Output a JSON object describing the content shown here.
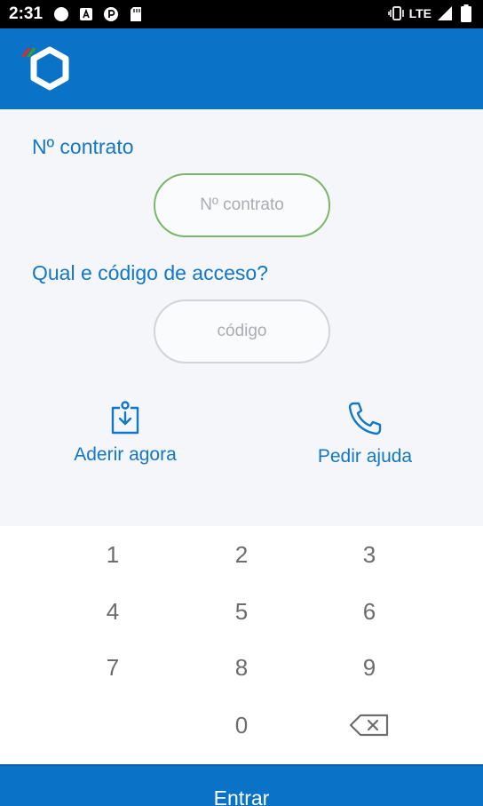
{
  "status_bar": {
    "time": "2:31",
    "network": "LTE",
    "icons": [
      "circle-icon",
      "font-a-icon",
      "pocket-p-icon",
      "sd-card-icon",
      "vibrate-icon",
      "signal-icon",
      "battery-icon"
    ]
  },
  "header": {
    "logo_icon": "cgd-logo-icon",
    "brand_color": "#0a73c8",
    "accent_colors": [
      "#e02a2a",
      "#2ea02e"
    ]
  },
  "form": {
    "contract": {
      "label": "Nº contrato",
      "placeholder": "Nº contrato",
      "value": ""
    },
    "code": {
      "label": "Qual e código de acceso?",
      "placeholder": "código",
      "value": ""
    }
  },
  "actions": {
    "adherir": {
      "label": "Aderir agora",
      "icon": "tray-download-icon"
    },
    "ajuda": {
      "label": "Pedir ajuda",
      "icon": "phone-icon"
    }
  },
  "keypad": {
    "keys": [
      "1",
      "2",
      "3",
      "4",
      "5",
      "6",
      "7",
      "8",
      "9",
      "0"
    ],
    "backspace_icon": "backspace-icon"
  },
  "footer": {
    "enter_label": "Entrar"
  },
  "colors": {
    "label_blue": "#1276c9",
    "focus_green": "#7cb56b",
    "background": "#f4f6f9"
  }
}
